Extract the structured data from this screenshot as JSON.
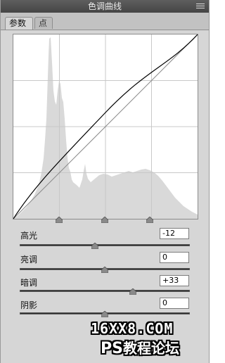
{
  "panel": {
    "title": "色调曲线",
    "menu_icon": "panel-menu-icon"
  },
  "tabs": [
    {
      "label": "参数",
      "active": true
    },
    {
      "label": "点",
      "active": false
    }
  ],
  "curve": {
    "background": "#ffffff",
    "histogram_color": "#d9d9d9",
    "grid_color": "#c8c8c8",
    "control_points": 3
  },
  "adjustments": [
    {
      "label": "高光",
      "value": "-12"
    },
    {
      "label": "亮调",
      "value": "0"
    },
    {
      "label": "暗调",
      "value": "+33"
    },
    {
      "label": "阴影",
      "value": "0"
    }
  ],
  "watermark": {
    "line1": "16XX8.COM",
    "ps": "PS",
    "line2": "教程论坛"
  }
}
